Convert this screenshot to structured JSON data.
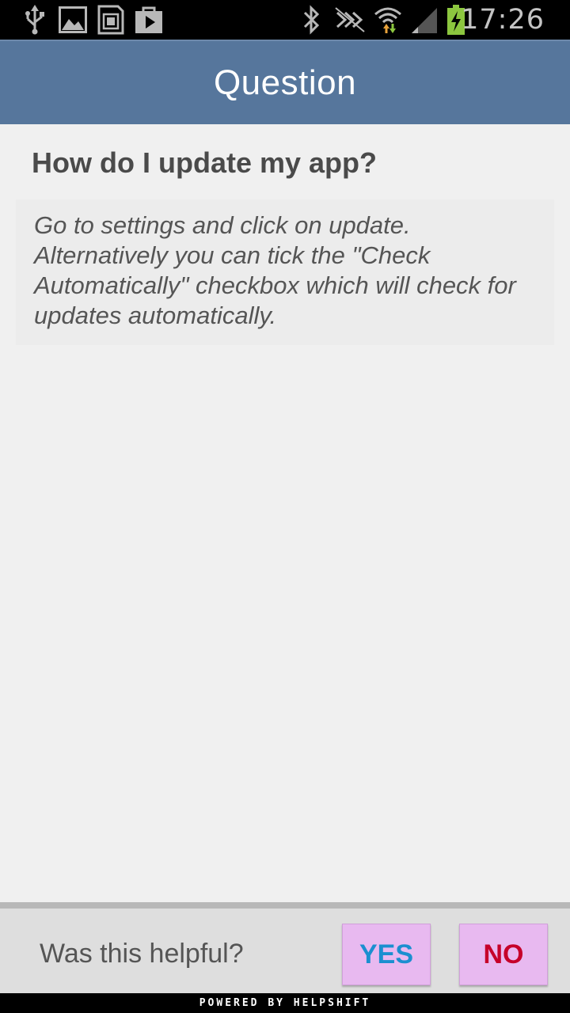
{
  "status_bar": {
    "time": "17:26",
    "left_icons": [
      "usb-icon",
      "image-icon",
      "sd-card-icon",
      "play-store-icon"
    ],
    "right_icons": [
      "bluetooth-icon",
      "nfc-icon",
      "wifi-icon",
      "signal-icon",
      "battery-charging-icon"
    ],
    "battery_color": "#8cc63f"
  },
  "action_bar": {
    "title": "Question",
    "color": "#56769c"
  },
  "question": {
    "title": "How do I update my app?",
    "answer": "Go to settings and click on update. Alternatively you can tick the \"Check Automatically\" checkbox which will check for updates automatically."
  },
  "feedback": {
    "prompt": "Was this helpful?",
    "yes_label": "YES",
    "no_label": "NO",
    "yes_color": "#1b8fd0",
    "no_color": "#c6002a",
    "button_bg": "#e8b9f0"
  },
  "footer": {
    "text": "POWERED BY HELPSHIFT"
  }
}
